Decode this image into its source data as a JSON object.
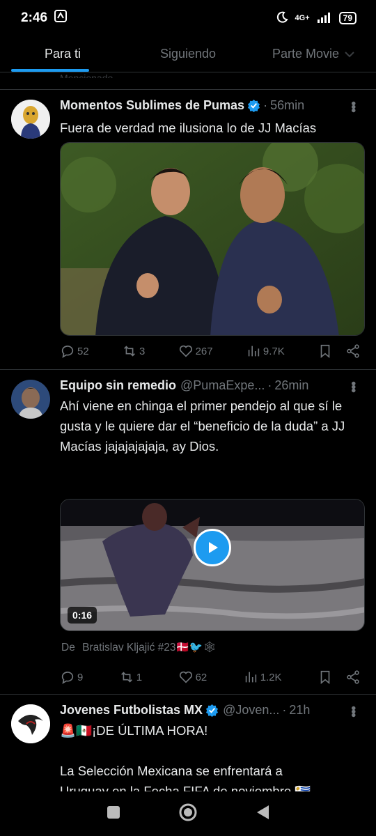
{
  "status": {
    "time": "2:46",
    "network": "4G+",
    "battery": "79"
  },
  "tabs": [
    {
      "label": "Para ti"
    },
    {
      "label": "Siguiendo"
    },
    {
      "label": "Parte Movie"
    }
  ],
  "pinned_strip": "Mencionado",
  "tweets": [
    {
      "name": "Momentos Sublimes de Pumas",
      "handle": "",
      "time": "56min",
      "text": "Fuera de verdad me ilusiona lo de JJ Macías",
      "replies": "52",
      "retweets": "3",
      "likes": "267",
      "views": "9.7K"
    },
    {
      "name": "Equipo sin remedio",
      "handle": "@PumaExpe...",
      "time": "26min",
      "text": "Ahí viene en chinga el primer pendejo al que sí le gusta y le quiere dar el “beneficio de la duda” a JJ Macías jajajajajaja, ay Dios.",
      "video_duration": "0:16",
      "from_label": "De",
      "from_user": "Bratislav Kljajić #23🇩🇰🐦🕸",
      "replies": "9",
      "retweets": "1",
      "likes": "62",
      "views": "1.2K"
    },
    {
      "name": "Jovenes Futbolistas MX",
      "handle": "@Joven...",
      "time": "21h",
      "line1": "🚨🇲🇽¡DE ÚLTIMA HORA!",
      "line2": "La Selección Mexicana se enfrentará a",
      "line3": "Uruguay en la Fecha FIFA de noviembre 🇺🇾"
    }
  ],
  "colors": {
    "accent": "#1d9bf0",
    "muted": "#71767b",
    "background": "#000000"
  }
}
